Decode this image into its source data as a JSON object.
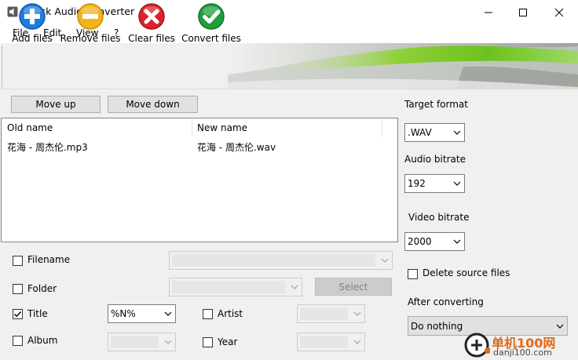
{
  "window": {
    "title": "Quick Audio Converter",
    "icon": "speaker-icon"
  },
  "menu": [
    "File",
    "Edit",
    "View",
    "?"
  ],
  "toolbar": {
    "add_files": "Add files",
    "remove_files": "Remove files",
    "clear_files": "Clear files",
    "convert_files": "Convert files"
  },
  "list_controls": {
    "move_up": "Move up",
    "move_down": "Move down"
  },
  "file_list": {
    "columns": [
      "Old name",
      "New name"
    ],
    "rows": [
      {
        "old_name": "花海 - 周杰伦.mp3",
        "new_name": "花海 - 周杰伦.wav"
      }
    ]
  },
  "tags": {
    "filename": {
      "label": "Filename",
      "checked": false
    },
    "folder": {
      "label": "Folder",
      "checked": false,
      "select_button": "Select"
    },
    "title": {
      "label": "Title",
      "checked": true,
      "value": "%N%"
    },
    "album": {
      "label": "Album",
      "checked": false
    },
    "artist": {
      "label": "Artist",
      "checked": false
    },
    "year": {
      "label": "Year",
      "checked": false
    }
  },
  "settings": {
    "target_format_label": "Target format",
    "target_format_value": ".WAV",
    "audio_bitrate_label": "Audio bitrate",
    "audio_bitrate_value": "192",
    "video_bitrate_label": "Video bitrate",
    "video_bitrate_value": "2000",
    "delete_source_label": "Delete source files",
    "delete_source_checked": false,
    "after_converting_label": "After converting",
    "after_converting_value": "Do nothing"
  },
  "watermark": {
    "text_cn": "单机100网",
    "text_url": "danji100.com"
  },
  "colors": {
    "add": "#1e7be0",
    "remove": "#f2b318",
    "clear": "#d9232a",
    "convert": "#1f9e3a",
    "watermark": "#e26a1b"
  }
}
